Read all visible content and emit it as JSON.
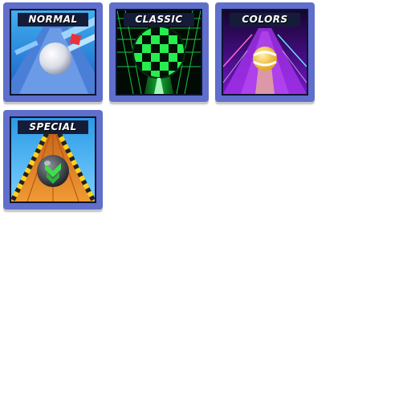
{
  "modes": [
    {
      "label": "NORMAL"
    },
    {
      "label": "CLASSIC"
    },
    {
      "label": "COLORS"
    },
    {
      "label": "SPECIAL"
    }
  ],
  "colors": {
    "frame": "#5f6fcb",
    "label_bg": "#141c3a",
    "normal_sky": "#2a8fe0",
    "classic_green": "#22e34a",
    "colors_purple": "#8a1fd6",
    "special_orange": "#e07a1a"
  }
}
